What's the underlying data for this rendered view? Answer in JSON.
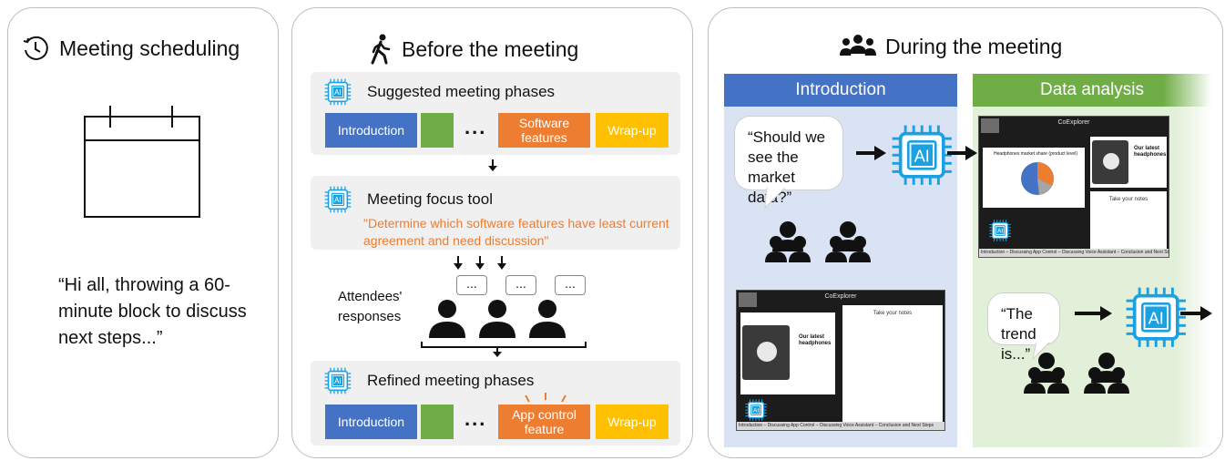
{
  "panel1": {
    "title": "Meeting scheduling",
    "quote": "“Hi all, throwing a 60-minute block to discuss next steps...”"
  },
  "panel2": {
    "title": "Before the meeting",
    "suggested": {
      "heading": "Suggested meeting phases",
      "chips": [
        "Introduction",
        "",
        "Software features",
        "Wrap-up"
      ],
      "dots": "..."
    },
    "focus": {
      "heading": "Meeting focus tool",
      "prompt": "\"Determine which software features have least current agreement and need discussion\""
    },
    "attendees_label": "Attendees' responses",
    "bubble_text": "...",
    "refined": {
      "heading": "Refined meeting phases",
      "chips": [
        "Introduction",
        "",
        "App control feature",
        "Wrap-up"
      ],
      "dots": "..."
    }
  },
  "panel3": {
    "title": "During the meeting",
    "phase1": {
      "label": "Introduction",
      "bubble": "“Should we see the market data?”",
      "screen": {
        "app_title": "CoExplorer",
        "notes_label": "Take your notes",
        "card_title": "Our latest headphones",
        "footer": "Introduction – Discussing App Control – Discussing Voice Assistant – Conclusion and Next Steps"
      }
    },
    "phase2": {
      "label": "Data analysis",
      "bubble": "“The trend is...”",
      "screen": {
        "app_title": "CoExplorer",
        "chart_title": "Headphones market share (product level)",
        "card_title": "Our latest headphones",
        "notes_label": "Take your notes",
        "footer": "Introduction – Discussing App Control – Discussing Voice Assistant – Conclusion and Next Steps"
      }
    }
  },
  "ai_label": "AI",
  "colors": {
    "blue": "#4472c4",
    "green": "#70ad47",
    "orange": "#ed7d31",
    "yellow": "#ffc000",
    "ai_blue": "#1ba1e2",
    "intro_bg": "#dae3f3",
    "analysis_bg": "#e2efd9"
  }
}
